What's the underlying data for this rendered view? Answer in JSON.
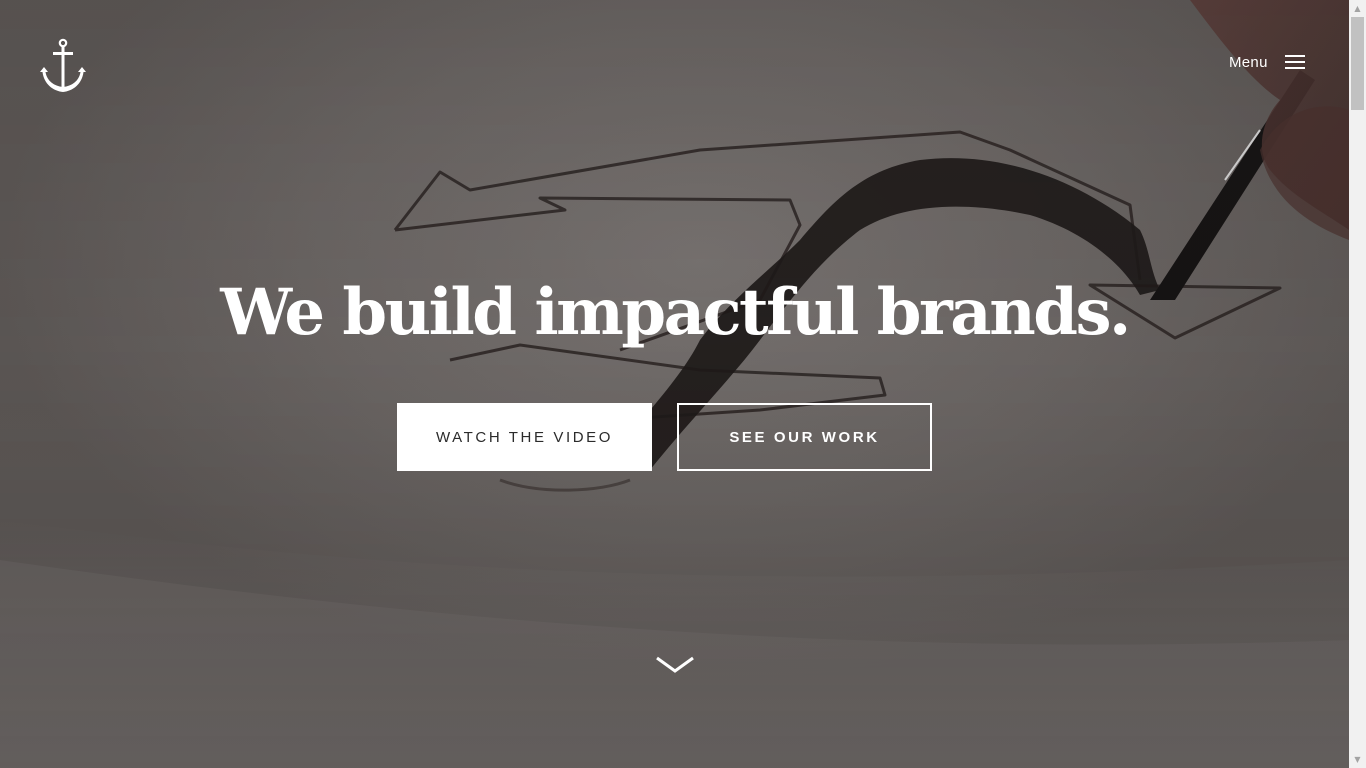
{
  "header": {
    "logo": "anchor-icon",
    "menu_label": "Menu",
    "menu_icon": "hamburger-icon"
  },
  "hero": {
    "headline": "We build impactful brands.",
    "primary_button": "WATCH THE VIDEO",
    "secondary_button": "SEE OUR WORK",
    "scroll_icon": "chevron-down-icon"
  },
  "colors": {
    "overlay": "#6a6563",
    "text": "#ffffff",
    "primary_button_bg": "#ffffff",
    "primary_button_text": "#2b2b2b"
  }
}
